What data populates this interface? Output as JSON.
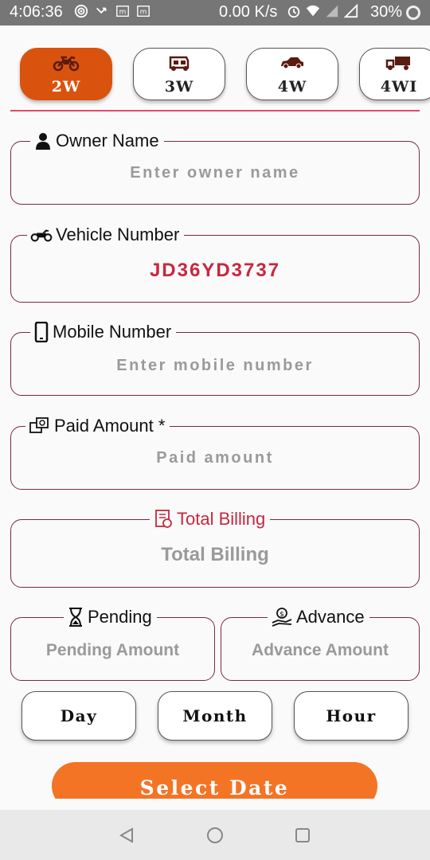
{
  "status_bar": {
    "time": "4:06:36",
    "network_speed": "0.00 K/s",
    "battery": "30%"
  },
  "vehicle_tabs": [
    {
      "label": "2W",
      "icon": "motorcycle-icon",
      "active": true
    },
    {
      "label": "3W",
      "icon": "auto-rickshaw-icon",
      "active": false
    },
    {
      "label": "4W",
      "icon": "car-icon",
      "active": false
    },
    {
      "label": "4WI",
      "icon": "truck-icon",
      "active": false
    }
  ],
  "fields": {
    "owner_name": {
      "label": "Owner Name",
      "placeholder": "Enter owner name",
      "value": ""
    },
    "vehicle_number": {
      "label": "Vehicle Number",
      "placeholder": "",
      "value": "JD36YD3737"
    },
    "mobile_number": {
      "label": "Mobile Number",
      "placeholder": "Enter mobile number",
      "value": ""
    },
    "paid_amount": {
      "label": "Paid Amount *",
      "placeholder": "Paid amount",
      "value": ""
    },
    "total_billing": {
      "label": "Total Billing",
      "placeholder": "Total Billing",
      "value": ""
    },
    "pending": {
      "label": "Pending",
      "placeholder": "Pending Amount",
      "value": ""
    },
    "advance": {
      "label": "Advance",
      "placeholder": "Advance Amount",
      "value": ""
    }
  },
  "period_buttons": {
    "day": "Day",
    "month": "Month",
    "hour": "Hour"
  },
  "select_date_label": "Select Date",
  "colors": {
    "accent_tab": "#d9530f",
    "select_date": "#f47425",
    "vehicle_number_text": "#c8273f",
    "border": "#7a2840"
  }
}
